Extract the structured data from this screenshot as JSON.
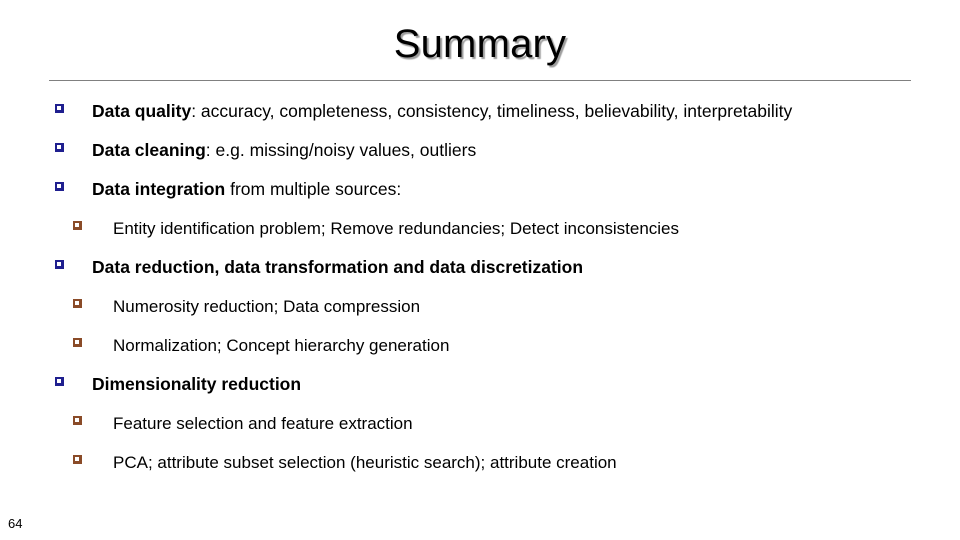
{
  "slide": {
    "title": "Summary",
    "page_number": "64",
    "colors": {
      "bullet_level1": "#1f1f8f",
      "bullet_level2": "#8a4b28",
      "rule": "#808080",
      "text": "#000000",
      "background": "#ffffff"
    },
    "bullets": [
      {
        "level": 1,
        "bullet_icon": "hollow-square-navy",
        "bold_lead": "Data quality",
        "rest": ": accuracy, completeness, consistency, timeliness, believability, interpretability",
        "all_bold": false
      },
      {
        "level": 1,
        "bullet_icon": "hollow-square-navy",
        "bold_lead": "Data cleaning",
        "rest": ": e.g. missing/noisy values, outliers",
        "all_bold": false
      },
      {
        "level": 1,
        "bullet_icon": "hollow-square-navy",
        "bold_lead": "Data integration",
        "rest": " from multiple sources:",
        "all_bold": false
      },
      {
        "level": 2,
        "bullet_icon": "hollow-square-brown",
        "bold_lead": "",
        "rest": "Entity identification problem; Remove redundancies; Detect inconsistencies",
        "all_bold": false
      },
      {
        "level": 1,
        "bullet_icon": "hollow-square-navy",
        "bold_lead": "Data reduction, data transformation and data discretization",
        "rest": "",
        "all_bold": true
      },
      {
        "level": 2,
        "bullet_icon": "hollow-square-brown",
        "bold_lead": "",
        "rest": "Numerosity reduction; Data compression",
        "all_bold": false
      },
      {
        "level": 2,
        "bullet_icon": "hollow-square-brown",
        "bold_lead": "",
        "rest": "Normalization; Concept hierarchy generation",
        "all_bold": false
      },
      {
        "level": 1,
        "bullet_icon": "hollow-square-navy",
        "bold_lead": "Dimensionality reduction",
        "rest": "",
        "all_bold": true
      },
      {
        "level": 2,
        "bullet_icon": "hollow-square-brown",
        "bold_lead": "",
        "rest": "Feature selection and feature extraction",
        "all_bold": false
      },
      {
        "level": 2,
        "bullet_icon": "hollow-square-brown",
        "bold_lead": "",
        "rest": "PCA; attribute subset selection (heuristic search); attribute creation",
        "all_bold": false
      }
    ]
  }
}
